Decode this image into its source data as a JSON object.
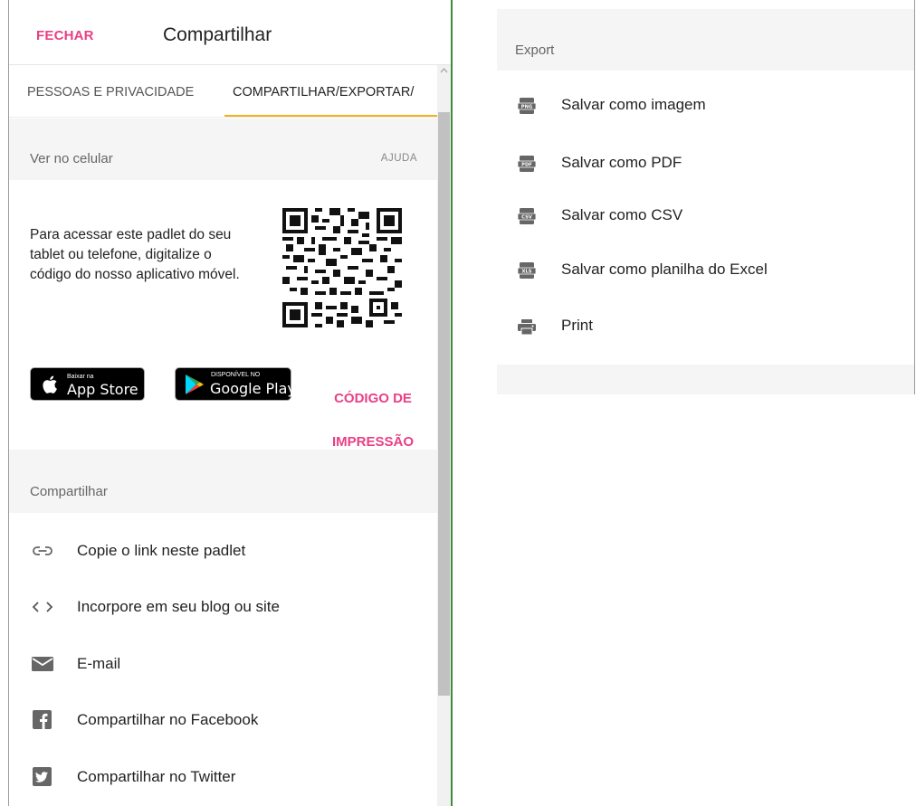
{
  "header": {
    "close_label": "FECHAR",
    "title": "Compartilhar"
  },
  "tabs": [
    {
      "label": "PESSOAS E PRIVACIDADE",
      "active": false
    },
    {
      "label": "COMPARTILHAR/EXPORTAR/",
      "active": true
    }
  ],
  "mobile_section": {
    "title": "Ver no celular",
    "help_label": "AJUDA",
    "description": "Para acessar este padlet do seu tablet ou telefone, digitalize o código do nosso aplicativo móvel.",
    "app_store": {
      "small": "Baixar na",
      "big": "App Store"
    },
    "google_play": {
      "small": "DISPONÍVEL NO",
      "big": "Google Play"
    },
    "print_code_line1": "CÓDIGO DE",
    "print_code_line2": "IMPRESSÃO"
  },
  "share_section": {
    "title": "Compartilhar",
    "items": [
      {
        "label": "Copie o link neste padlet",
        "icon": "link-icon"
      },
      {
        "label": "Incorpore em seu blog ou site",
        "icon": "code-icon"
      },
      {
        "label": "E-mail",
        "icon": "email-icon"
      },
      {
        "label": "Compartilhar no Facebook",
        "icon": "facebook-icon"
      },
      {
        "label": "Compartilhar no Twitter",
        "icon": "twitter-icon"
      }
    ]
  },
  "export_section": {
    "title": "Export",
    "items": [
      {
        "label": "Salvar como imagem",
        "icon": "png-file-icon",
        "badge": "PNG"
      },
      {
        "label": "Salvar como PDF",
        "icon": "pdf-file-icon",
        "badge": "PDF"
      },
      {
        "label": "Salvar como CSV",
        "icon": "csv-file-icon",
        "badge": "CSV"
      },
      {
        "label": "Salvar como planilha do Excel",
        "icon": "xls-file-icon",
        "badge": "XLS"
      },
      {
        "label": "Print",
        "icon": "printer-icon"
      }
    ]
  },
  "colors": {
    "accent_pink": "#ea3f86",
    "tab_underline": "#f3b21c",
    "divider_green": "#3b8c3b",
    "section_bg": "#f5f5f5"
  }
}
